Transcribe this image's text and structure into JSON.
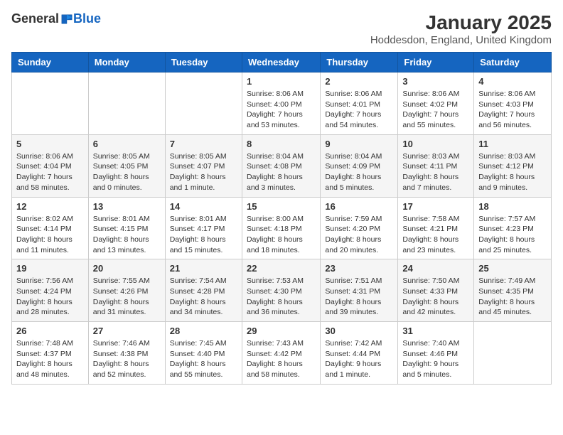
{
  "logo": {
    "general": "General",
    "blue": "Blue"
  },
  "header": {
    "title": "January 2025",
    "location": "Hoddesdon, England, United Kingdom"
  },
  "days_of_week": [
    "Sunday",
    "Monday",
    "Tuesday",
    "Wednesday",
    "Thursday",
    "Friday",
    "Saturday"
  ],
  "weeks": [
    [
      {
        "day": "",
        "info": ""
      },
      {
        "day": "",
        "info": ""
      },
      {
        "day": "",
        "info": ""
      },
      {
        "day": "1",
        "info": "Sunrise: 8:06 AM\nSunset: 4:00 PM\nDaylight: 7 hours and 53 minutes."
      },
      {
        "day": "2",
        "info": "Sunrise: 8:06 AM\nSunset: 4:01 PM\nDaylight: 7 hours and 54 minutes."
      },
      {
        "day": "3",
        "info": "Sunrise: 8:06 AM\nSunset: 4:02 PM\nDaylight: 7 hours and 55 minutes."
      },
      {
        "day": "4",
        "info": "Sunrise: 8:06 AM\nSunset: 4:03 PM\nDaylight: 7 hours and 56 minutes."
      }
    ],
    [
      {
        "day": "5",
        "info": "Sunrise: 8:06 AM\nSunset: 4:04 PM\nDaylight: 7 hours and 58 minutes."
      },
      {
        "day": "6",
        "info": "Sunrise: 8:05 AM\nSunset: 4:05 PM\nDaylight: 8 hours and 0 minutes."
      },
      {
        "day": "7",
        "info": "Sunrise: 8:05 AM\nSunset: 4:07 PM\nDaylight: 8 hours and 1 minute."
      },
      {
        "day": "8",
        "info": "Sunrise: 8:04 AM\nSunset: 4:08 PM\nDaylight: 8 hours and 3 minutes."
      },
      {
        "day": "9",
        "info": "Sunrise: 8:04 AM\nSunset: 4:09 PM\nDaylight: 8 hours and 5 minutes."
      },
      {
        "day": "10",
        "info": "Sunrise: 8:03 AM\nSunset: 4:11 PM\nDaylight: 8 hours and 7 minutes."
      },
      {
        "day": "11",
        "info": "Sunrise: 8:03 AM\nSunset: 4:12 PM\nDaylight: 8 hours and 9 minutes."
      }
    ],
    [
      {
        "day": "12",
        "info": "Sunrise: 8:02 AM\nSunset: 4:14 PM\nDaylight: 8 hours and 11 minutes."
      },
      {
        "day": "13",
        "info": "Sunrise: 8:01 AM\nSunset: 4:15 PM\nDaylight: 8 hours and 13 minutes."
      },
      {
        "day": "14",
        "info": "Sunrise: 8:01 AM\nSunset: 4:17 PM\nDaylight: 8 hours and 15 minutes."
      },
      {
        "day": "15",
        "info": "Sunrise: 8:00 AM\nSunset: 4:18 PM\nDaylight: 8 hours and 18 minutes."
      },
      {
        "day": "16",
        "info": "Sunrise: 7:59 AM\nSunset: 4:20 PM\nDaylight: 8 hours and 20 minutes."
      },
      {
        "day": "17",
        "info": "Sunrise: 7:58 AM\nSunset: 4:21 PM\nDaylight: 8 hours and 23 minutes."
      },
      {
        "day": "18",
        "info": "Sunrise: 7:57 AM\nSunset: 4:23 PM\nDaylight: 8 hours and 25 minutes."
      }
    ],
    [
      {
        "day": "19",
        "info": "Sunrise: 7:56 AM\nSunset: 4:24 PM\nDaylight: 8 hours and 28 minutes."
      },
      {
        "day": "20",
        "info": "Sunrise: 7:55 AM\nSunset: 4:26 PM\nDaylight: 8 hours and 31 minutes."
      },
      {
        "day": "21",
        "info": "Sunrise: 7:54 AM\nSunset: 4:28 PM\nDaylight: 8 hours and 34 minutes."
      },
      {
        "day": "22",
        "info": "Sunrise: 7:53 AM\nSunset: 4:30 PM\nDaylight: 8 hours and 36 minutes."
      },
      {
        "day": "23",
        "info": "Sunrise: 7:51 AM\nSunset: 4:31 PM\nDaylight: 8 hours and 39 minutes."
      },
      {
        "day": "24",
        "info": "Sunrise: 7:50 AM\nSunset: 4:33 PM\nDaylight: 8 hours and 42 minutes."
      },
      {
        "day": "25",
        "info": "Sunrise: 7:49 AM\nSunset: 4:35 PM\nDaylight: 8 hours and 45 minutes."
      }
    ],
    [
      {
        "day": "26",
        "info": "Sunrise: 7:48 AM\nSunset: 4:37 PM\nDaylight: 8 hours and 48 minutes."
      },
      {
        "day": "27",
        "info": "Sunrise: 7:46 AM\nSunset: 4:38 PM\nDaylight: 8 hours and 52 minutes."
      },
      {
        "day": "28",
        "info": "Sunrise: 7:45 AM\nSunset: 4:40 PM\nDaylight: 8 hours and 55 minutes."
      },
      {
        "day": "29",
        "info": "Sunrise: 7:43 AM\nSunset: 4:42 PM\nDaylight: 8 hours and 58 minutes."
      },
      {
        "day": "30",
        "info": "Sunrise: 7:42 AM\nSunset: 4:44 PM\nDaylight: 9 hours and 1 minute."
      },
      {
        "day": "31",
        "info": "Sunrise: 7:40 AM\nSunset: 4:46 PM\nDaylight: 9 hours and 5 minutes."
      },
      {
        "day": "",
        "info": ""
      }
    ]
  ]
}
